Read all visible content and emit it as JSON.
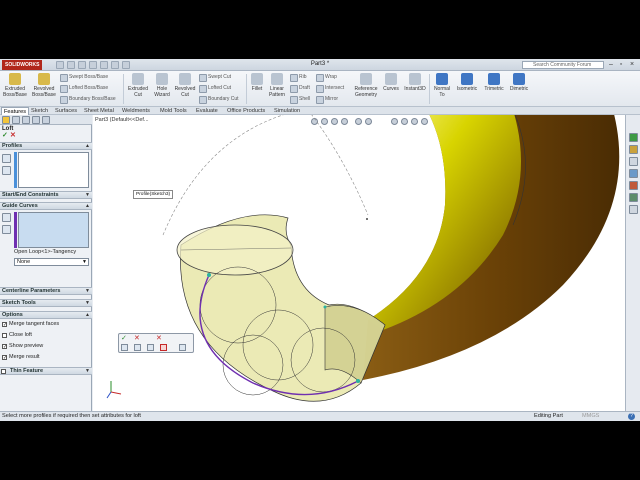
{
  "titlebar": {
    "logo_text": "SOLIDWORKS",
    "document_title": "Part3 *",
    "search_placeholder": "Search Community Forum"
  },
  "ribbon": {
    "extruded_boss": "Extruded Boss/Base",
    "revolved_boss": "Revolved Boss/Base",
    "swept_boss": "Swept Boss/Base",
    "lofted_boss": "Lofted Boss/Base",
    "boundary_boss": "Boundary Boss/Base",
    "extruded_cut": "Extruded Cut",
    "hole_wizard": "Hole Wizard",
    "revolved_cut": "Revolved Cut",
    "swept_cut": "Swept Cut",
    "lofted_cut": "Lofted Cut",
    "boundary_cut": "Boundary Cut",
    "fillet": "Fillet",
    "linear_pattern": "Linear Pattern",
    "rib": "Rib",
    "draft": "Draft",
    "shell": "Shell",
    "wrap": "Wrap",
    "intersect": "Intersect",
    "mirror": "Mirror",
    "reference_geometry": "Reference Geometry",
    "curves": "Curves",
    "instant3d": "Instant3D",
    "normal_to": "Normal To",
    "isometric": "Isometric",
    "trimetric": "Trimetric",
    "dimetric": "Dimetric"
  },
  "tabs": [
    "Features",
    "Sketch",
    "Surfaces",
    "Sheet Metal",
    "Weldments",
    "Mold Tools",
    "Evaluate",
    "Office Products",
    "Simulation"
  ],
  "panel": {
    "title": "Loft",
    "profiles": "Profiles",
    "start_end_constraints": "Start/End Constraints",
    "guide_curves": "Guide Curves",
    "guide_curve_item": "Open Loop<1>-Tangency",
    "guide_influence": "None",
    "centerline_parameters": "Centerline Parameters",
    "sketch_tools": "Sketch Tools",
    "options": "Options",
    "merge_tangent_faces": "Merge tangent faces",
    "close_loft": "Close loft",
    "show_preview": "Show preview",
    "merge_result": "Merge result",
    "thin_feature": "Thin Feature"
  },
  "viewport": {
    "breadcrumb": "Part3 (Default<<Def...",
    "callout": "Profile(Sketch3)"
  },
  "statusbar": {
    "message": "Select more profiles if required then set attributes for loft",
    "mode": "Editing Part",
    "units": "MMGS",
    "help": "?"
  },
  "colors": {
    "selection_purple": "#6f2fb0",
    "preview_yellow": "#e8e6a8",
    "solid_gold": "#c8c400"
  }
}
